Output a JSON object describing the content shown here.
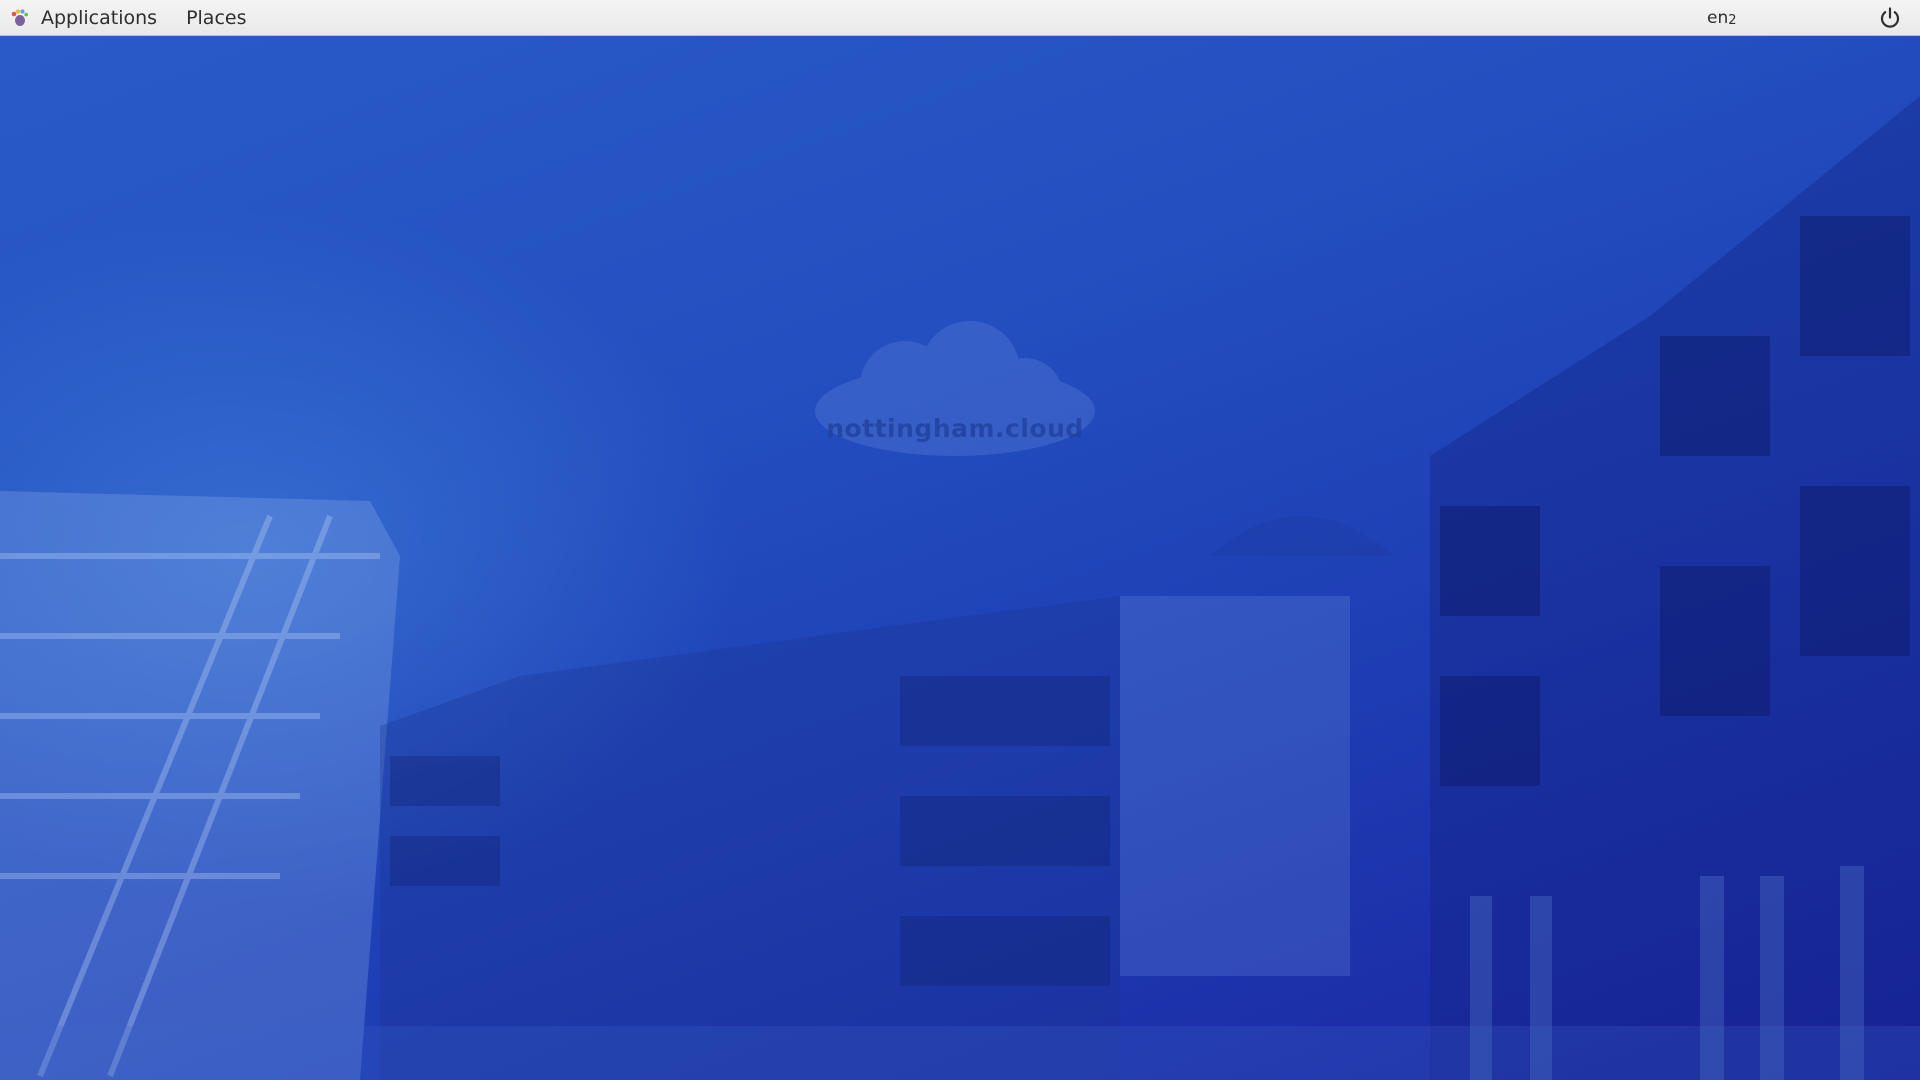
{
  "top_panel": {
    "applications_label": "Applications",
    "places_label": "Places",
    "keyboard_layout": "en",
    "keyboard_layout_index": "2",
    "apps_icon": "gnome-foot-icon",
    "power_icon": "power-icon"
  },
  "desktop": {
    "wallpaper_brand": "nottingham.cloud"
  },
  "colors": {
    "panel_bg": "#ececec",
    "desktop_blue": "#2350c0",
    "desktop_deep_blue": "#1a24a0"
  }
}
